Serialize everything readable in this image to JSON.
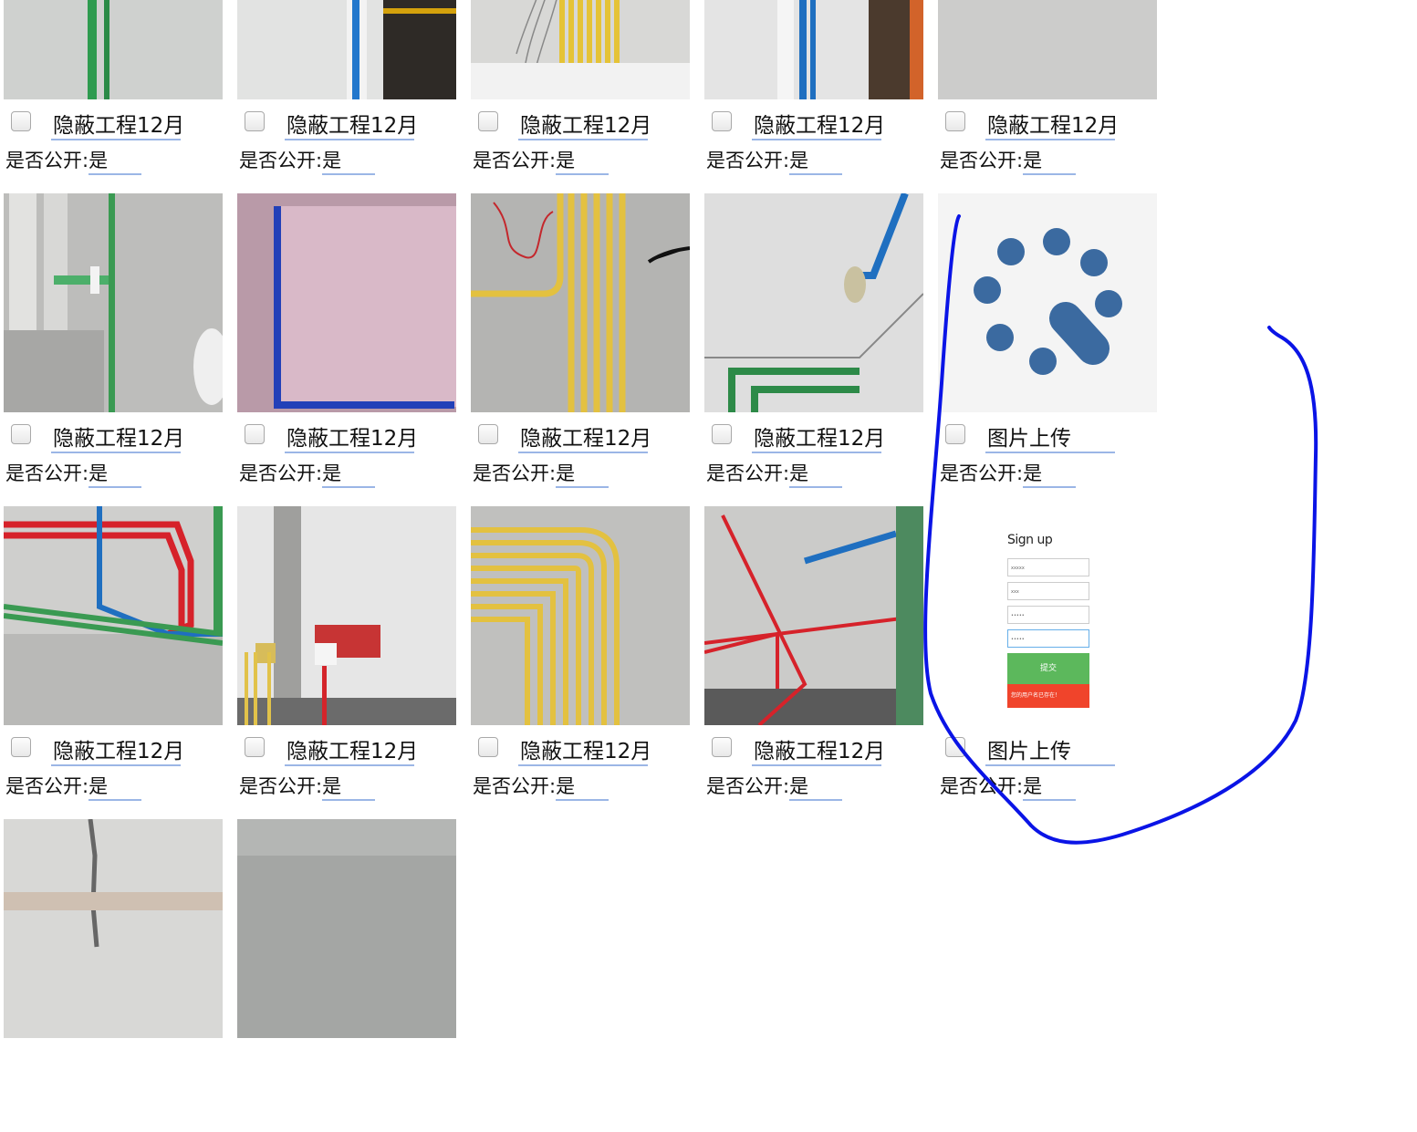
{
  "tiles": [
    {
      "title": "隐蔽工程12月",
      "public_label": "是否公开:",
      "public_value": "是",
      "photo": "wall-green-pipe"
    },
    {
      "title": "隐蔽工程12月",
      "public_label": "是否公开:",
      "public_value": "是",
      "photo": "wall-blue-pipe-door"
    },
    {
      "title": "隐蔽工程12月",
      "public_label": "是否公开:",
      "public_value": "是",
      "photo": "yellow-conduits-wires"
    },
    {
      "title": "隐蔽工程12月",
      "public_label": "是否公开:",
      "public_value": "是",
      "photo": "wall-blue-pipe"
    },
    {
      "title": "隐蔽工程12月",
      "public_label": "是否公开:",
      "public_value": "是",
      "photo": "wall-red-pipe-box"
    },
    {
      "title": "隐蔽工程12月",
      "public_label": "是否公开:",
      "public_value": "是",
      "photo": "bathroom-pipes"
    },
    {
      "title": "隐蔽工程12月",
      "public_label": "是否公开:",
      "public_value": "是",
      "photo": "pink-wall-blue-pipe"
    },
    {
      "title": "隐蔽工程12月",
      "public_label": "是否公开:",
      "public_value": "是",
      "photo": "floor-yellow-conduits"
    },
    {
      "title": "隐蔽工程12月",
      "public_label": "是否公开:",
      "public_value": "是",
      "photo": "ceiling-blue-green"
    },
    {
      "title": "图片上传",
      "public_label": "是否公开:",
      "public_value": "是",
      "photo": "loading-spinner"
    },
    {
      "title": "隐蔽工程12月",
      "public_label": "是否公开:",
      "public_value": "是",
      "photo": "ceiling-red-blue-green"
    },
    {
      "title": "隐蔽工程12月",
      "public_label": "是否公开:",
      "public_value": "是",
      "photo": "wall-outlet-boxes"
    },
    {
      "title": "隐蔽工程12月",
      "public_label": "是否公开:",
      "public_value": "是",
      "photo": "floor-yellow-bend"
    },
    {
      "title": "隐蔽工程12月",
      "public_label": "是否公开:",
      "public_value": "是",
      "photo": "ceiling-red-pipe"
    },
    {
      "title": "图片上传",
      "public_label": "是否公开:",
      "public_value": "是",
      "photo": "signup-form"
    },
    {
      "title": "",
      "public_label": "",
      "public_value": "",
      "photo": "wall-crack"
    },
    {
      "title": "",
      "public_label": "",
      "public_value": "",
      "photo": "concrete-ceiling"
    }
  ],
  "signup_form": {
    "heading": "Sign up",
    "fields": [
      "xxxxx",
      "xxx",
      "•••••",
      "•••••"
    ],
    "submit_label": "提交",
    "error_text": "您的用户名已存在！"
  },
  "colors": {
    "annotation_stroke": "#0a14e6",
    "underline": "#9bb6e6",
    "spinner": "#3b6aa0"
  }
}
